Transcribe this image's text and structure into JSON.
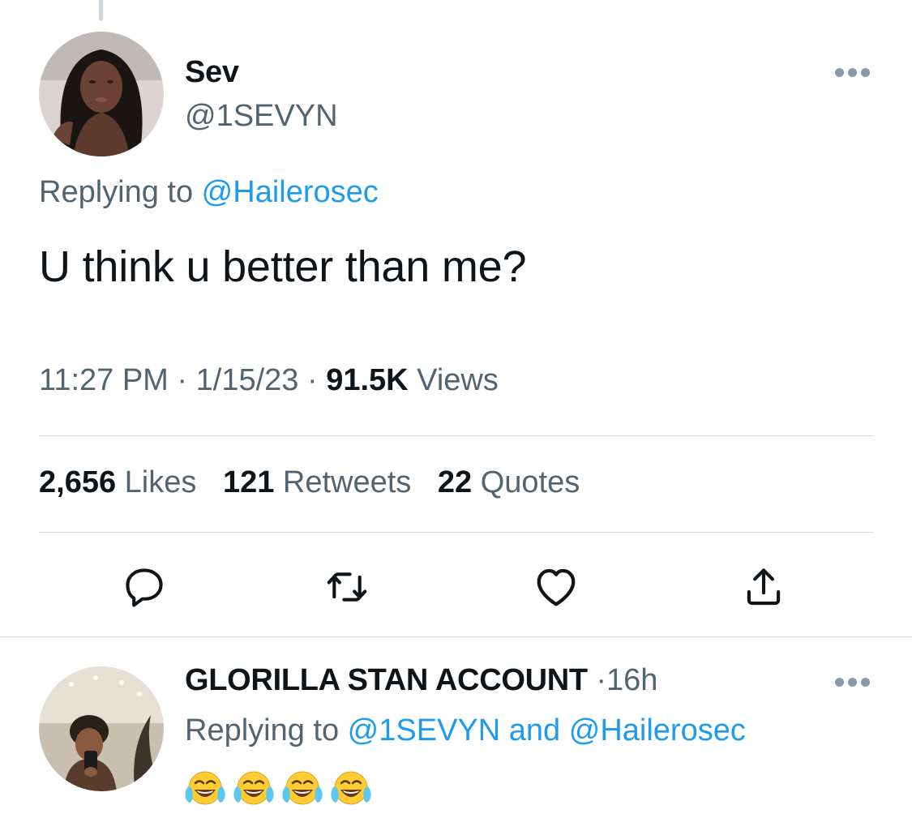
{
  "tweet": {
    "display_name": "Sev",
    "handle": "@1SEVYN",
    "replying_prefix": "Replying to ",
    "replying_mention": "@Hailerosec",
    "text": "U think u better than me?",
    "time": "11:27 PM",
    "date": "1/15/23",
    "separator": "·",
    "views_count": "91.5K",
    "views_label": "Views",
    "likes_count": "2,656",
    "likes_label": "Likes",
    "retweets_count": "121",
    "retweets_label": "Retweets",
    "quotes_count": "22",
    "quotes_label": "Quotes"
  },
  "actions": {
    "icons": [
      "reply-icon",
      "retweet-icon",
      "like-icon",
      "share-icon"
    ]
  },
  "reply": {
    "display_name": "GLORILLA STAN ACCOUNT",
    "separator": "·",
    "time": "16h",
    "replying_prefix": "Replying to ",
    "mention_1": "@1SEVYN",
    "connector": " and ",
    "mention_2": "@Hailerosec",
    "emoji_count": 4,
    "emoji_name": "face-with-tears-of-joy"
  },
  "colors": {
    "link": "#1d9bf0",
    "secondary_text": "#536471",
    "primary_text": "#0f1419",
    "divider": "#cfd9de"
  }
}
